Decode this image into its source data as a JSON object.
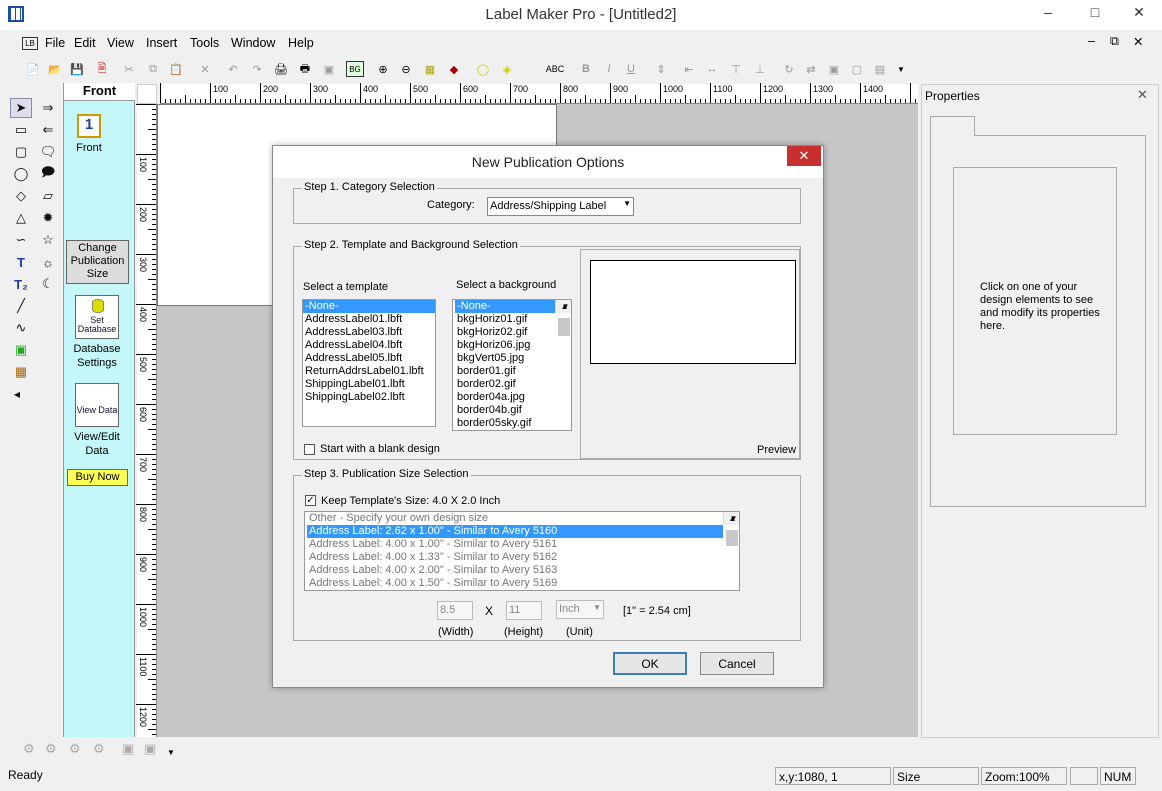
{
  "window": {
    "title": "Label Maker Pro - [Untitled2]"
  },
  "menu": [
    "File",
    "Edit",
    "View",
    "Insert",
    "Tools",
    "Window",
    "Help"
  ],
  "side_panel": {
    "tab": "Front",
    "page_icon_number": "1",
    "page_label": "Front",
    "change_size": "Change Publication Size",
    "db_icon": "Set Database",
    "db_label": "Database Settings",
    "view_icon": "View Data",
    "view_label": "View/Edit Data",
    "buy": "Buy Now"
  },
  "ruler": {
    "h_ticks": [
      "100",
      "200",
      "300",
      "400",
      "500",
      "600",
      "700",
      "800",
      "900",
      "1000",
      "1100",
      "1200",
      "1300",
      "1400"
    ],
    "v_ticks": [
      "100",
      "200",
      "300",
      "400",
      "500",
      "600",
      "700",
      "800",
      "900",
      "1000",
      "1100",
      "1200"
    ]
  },
  "properties": {
    "title": "Properties",
    "hint": "Click on one of your design elements to see and modify its properties here."
  },
  "dialog": {
    "title": "New Publication Options",
    "step1": {
      "title": "Step 1. Category Selection",
      "label": "Category:",
      "value": "Address/Shipping Label"
    },
    "step2": {
      "title": "Step 2. Template and Background Selection",
      "template_label": "Select a template",
      "background_label": "Select a background",
      "templates": [
        "-None-",
        "AddressLabel01.lbft",
        "AddressLabel03.lbft",
        "AddressLabel04.lbft",
        "AddressLabel05.lbft",
        "ReturnAddrsLabel01.lbft",
        "ShippingLabel01.lbft",
        "ShippingLabel02.lbft"
      ],
      "backgrounds": [
        "-None-",
        "bkgHoriz01.gif",
        "bkgHoriz02.gif",
        "bkgHoriz06.jpg",
        "bkgVert05.jpg",
        "border01.gif",
        "border02.gif",
        "border04a.jpg",
        "border04b.gif",
        "border05sky.gif"
      ],
      "blank": "Start with a blank design",
      "preview": "Preview"
    },
    "step3": {
      "title": "Step 3. Publication Size Selection",
      "keep": "Keep Template's Size: 4.0 X 2.0 Inch",
      "sizes": [
        "Other - Specify your own design size",
        "Address Label: 2.62 x 1.00\" - Similar to Avery 5160",
        "Address Label: 4.00 x 1.00\" - Similar to Avery 5161",
        "Address Label: 4.00 x 1.33\" - Similar to Avery 5162",
        "Address Label: 4.00 x 2.00\" - Similar to Avery 5163",
        "Address Label: 4.00 x 1.50\" - Similar to Avery 5169"
      ],
      "width": "8.5",
      "x": "X",
      "height": "11",
      "unit": "Inch",
      "conv": "[1\" = 2.54 cm]",
      "width_lbl": "(Width)",
      "height_lbl": "(Height)",
      "unit_lbl": "(Unit)"
    },
    "ok": "OK",
    "cancel": "Cancel"
  },
  "status": {
    "ready": "Ready",
    "xy": "x,y:1080, 1",
    "size": "Size",
    "zoom": "Zoom:100%",
    "num": "NUM"
  }
}
